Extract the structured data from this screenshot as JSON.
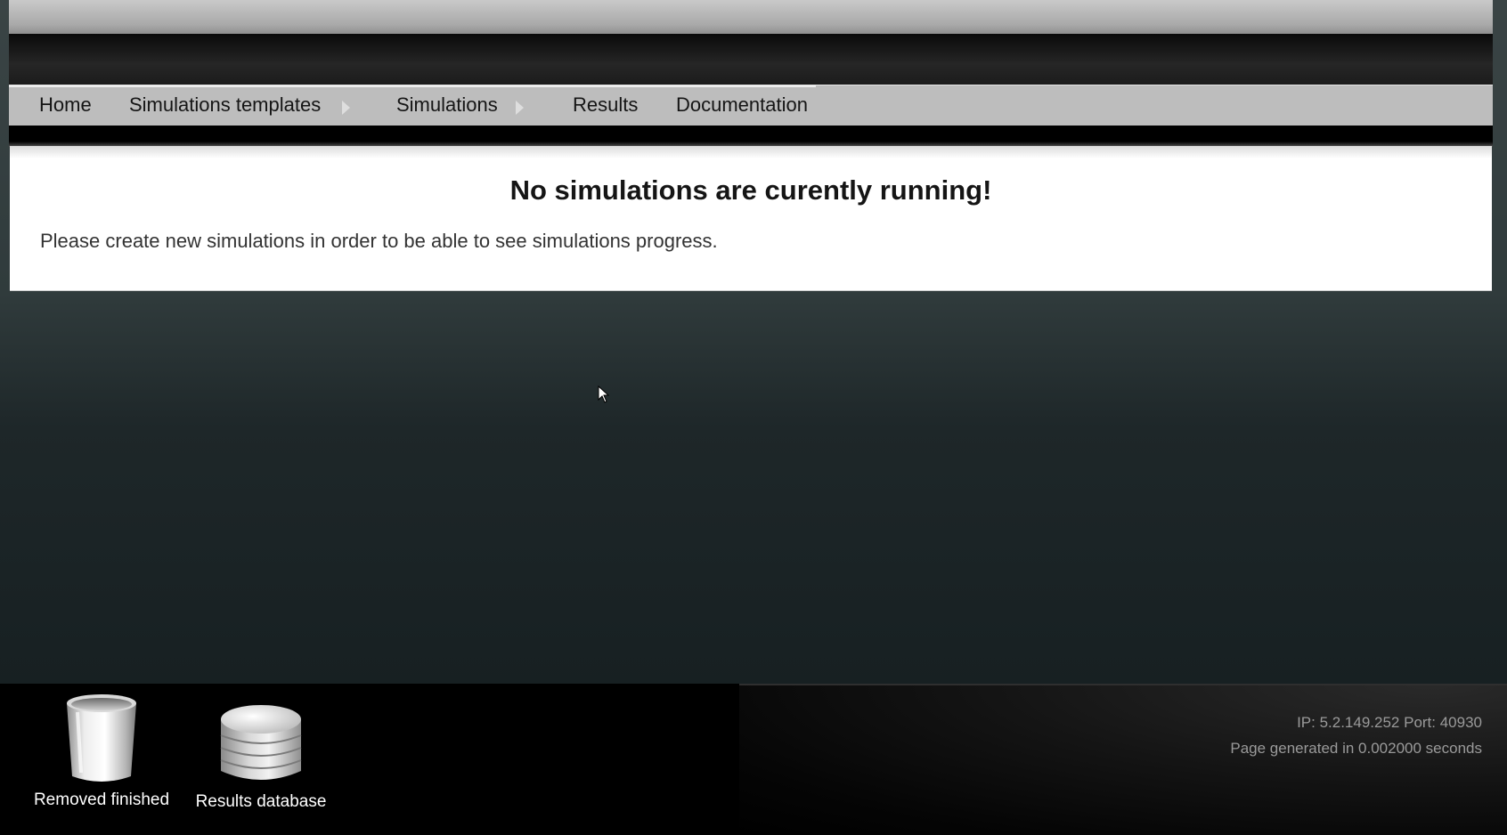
{
  "nav": {
    "items": [
      {
        "label": "Home",
        "has_submenu": false
      },
      {
        "label": "Simulations templates",
        "has_submenu": true
      },
      {
        "label": "Simulations",
        "has_submenu": true
      },
      {
        "label": "Results",
        "has_submenu": false
      },
      {
        "label": "Documentation",
        "has_submenu": false
      }
    ]
  },
  "main": {
    "title": "No simulations are curently running!",
    "message": "Please create new simulations in order to be able to see simulations progress."
  },
  "footer": {
    "tools": [
      {
        "label": "Removed finished",
        "icon": "trash-bin-icon"
      },
      {
        "label": "Results database",
        "icon": "database-icon"
      }
    ],
    "server_info": "IP: 5.2.149.252 Port: 40930",
    "generated": "Page generated in 0.002000 seconds"
  },
  "colors": {
    "nav_background": "#bdbdbd",
    "page_background": "#2a3436",
    "footer_background": "#000000",
    "panel_background": "#ffffff"
  }
}
